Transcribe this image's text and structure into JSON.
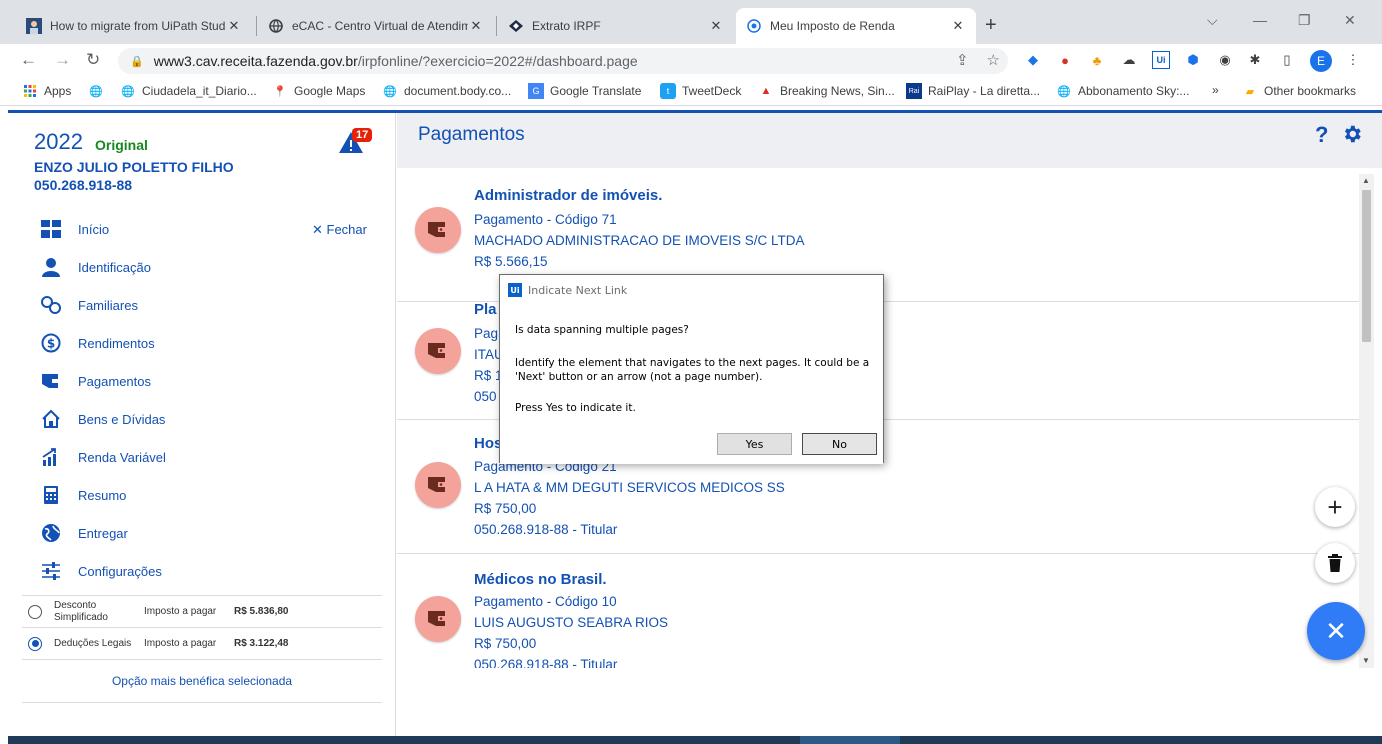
{
  "browser": {
    "tabs": [
      {
        "title": "How to migrate from UiPath Stud",
        "icon": "uipath-favicon",
        "active": false
      },
      {
        "title": "eCAC - Centro Virtual de Atendim",
        "icon": "globe-favicon",
        "active": false
      },
      {
        "title": "Extrato IRPF",
        "icon": "irpf-favicon",
        "active": false
      },
      {
        "title": "Meu Imposto de Renda",
        "icon": "loading-favicon",
        "active": true
      }
    ],
    "url_host": "www3.cav.receita.fazenda.gov.br",
    "url_rest": "/irpfonline/?exercicio=2022#/dashboard.page",
    "profile_initial": "E",
    "bookmarks": [
      {
        "label": "Apps",
        "icon": "apps-grid-icon"
      },
      {
        "label": "",
        "icon": "globe-icon"
      },
      {
        "label": "Ciudadela_it_Diario...",
        "icon": "globe-icon"
      },
      {
        "label": "Google Maps",
        "icon": "maps-pin-icon"
      },
      {
        "label": "document.body.co...",
        "icon": "globe-icon"
      },
      {
        "label": "Google Translate",
        "icon": "translate-icon"
      },
      {
        "label": "TweetDeck",
        "icon": "tweetdeck-icon"
      },
      {
        "label": "Breaking News, Sin...",
        "icon": "red-triangle-icon"
      },
      {
        "label": "RaiPlay - La diretta...",
        "icon": "raiplay-icon"
      },
      {
        "label": "Abbonamento Sky:...",
        "icon": "globe-icon"
      }
    ],
    "more_bookmarks": "»",
    "other_bookmarks": "Other bookmarks"
  },
  "sidebar": {
    "year": "2022",
    "declaration_type": "Original",
    "alert_count": "17",
    "user_name": "ENZO JULIO POLETTO FILHO",
    "cpf": "050.268.918-88",
    "close_label": "Fechar",
    "menu": [
      {
        "label": "Início",
        "icon": "dashboard-grid-icon"
      },
      {
        "label": "Identificação",
        "icon": "person-icon"
      },
      {
        "label": "Familiares",
        "icon": "family-icon"
      },
      {
        "label": "Rendimentos",
        "icon": "dollar-circle-icon"
      },
      {
        "label": "Pagamentos",
        "icon": "wallet-icon"
      },
      {
        "label": "Bens e Dívidas",
        "icon": "house-icon"
      },
      {
        "label": "Renda Variável",
        "icon": "chart-growth-icon"
      },
      {
        "label": "Resumo",
        "icon": "calculator-icon"
      },
      {
        "label": "Entregar",
        "icon": "globe-send-icon"
      },
      {
        "label": "Configurações",
        "icon": "sliders-icon"
      }
    ],
    "options": [
      {
        "name": "Desconto Simplificado",
        "label": "Imposto a pagar",
        "value": "R$ 5.836,80",
        "selected": false
      },
      {
        "name": "Deduções Legais",
        "label": "Imposto a pagar",
        "value": "R$ 3.122,48",
        "selected": true
      }
    ],
    "options_footer": "Opção mais benéfica selecionada"
  },
  "main": {
    "title": "Pagamentos",
    "help_label": "?",
    "cards": [
      {
        "title": "Administrador de imóveis.",
        "line1": "Pagamento - Código 71",
        "line2": "MACHADO ADMINISTRACAO DE IMOVEIS S/C LTDA",
        "line3": "R$ 5.566,15",
        "line4": ""
      },
      {
        "title": "Pla",
        "line1": "Pag",
        "line2": "ITAU",
        "line3": "R$ 1",
        "line4": "050"
      },
      {
        "title": "Hos",
        "line1": "Pagamento - Código 21",
        "line2": "L A HATA & MM DEGUTI SERVICOS MEDICOS SS",
        "line3": "R$ 750,00",
        "line4": "050.268.918-88 - Titular"
      },
      {
        "title": "Médicos no Brasil.",
        "line1": "Pagamento - Código 10",
        "line2": "LUIS AUGUSTO SEABRA RIOS",
        "line3": "R$ 750,00",
        "line4": "050.268.918-88 - Titular"
      }
    ]
  },
  "dialog": {
    "title": "Indicate Next Link",
    "logo_text": "Ui",
    "question": "Is data spanning multiple pages?",
    "description": "Identify the element that navigates to the next pages. It could be a 'Next' button or an arrow (not a page number).",
    "prompt": "Press Yes to indicate it.",
    "yes_label": "Yes",
    "no_label": "No"
  },
  "colors": {
    "brand_blue": "#1351b4",
    "original_green": "#168821",
    "card_icon_bg": "#f4a39a",
    "fab_blue": "#2f7cf6",
    "alert_red": "#e52207"
  }
}
